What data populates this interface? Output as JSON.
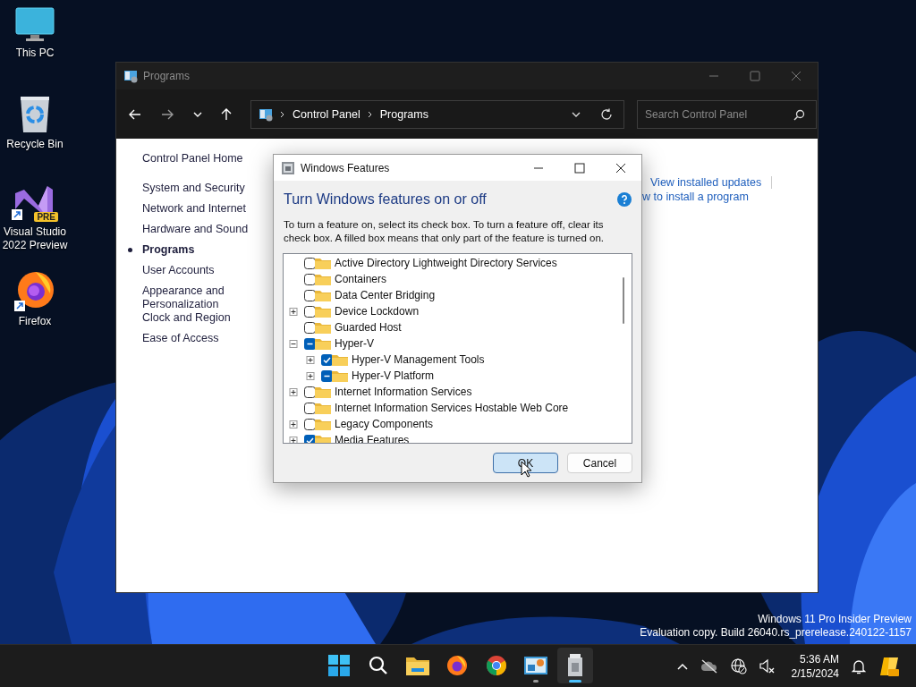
{
  "desktop_icons": [
    {
      "label": "This PC",
      "kind": "monitor"
    },
    {
      "label": "Recycle Bin",
      "kind": "bin"
    },
    {
      "label": "Visual Studio 2022 Preview",
      "kind": "vs",
      "badge": "PRE",
      "shortcut": true
    },
    {
      "label": "Firefox",
      "kind": "firefox",
      "shortcut": true
    }
  ],
  "window": {
    "title": "Programs",
    "breadcrumb": [
      "Control Panel",
      "Programs"
    ],
    "search": {
      "placeholder": "Search Control Panel"
    },
    "nav": [
      {
        "label": "Control Panel Home",
        "selected": false
      },
      {
        "label": "System and Security",
        "selected": false
      },
      {
        "label": "Network and Internet",
        "selected": false
      },
      {
        "label": "Hardware and Sound",
        "selected": false
      },
      {
        "label": "Programs",
        "selected": true
      },
      {
        "label": "User Accounts",
        "selected": false
      },
      {
        "label": "Appearance and Personalization",
        "selected": false
      },
      {
        "label": "Clock and Region",
        "selected": false
      },
      {
        "label": "Ease of Access",
        "selected": false
      }
    ],
    "links": [
      "View installed updates",
      "w to install a program"
    ]
  },
  "dialog": {
    "title": "Windows Features",
    "heading": "Turn Windows features on or off",
    "description": "To turn a feature on, select its check box. To turn a feature off, clear its check box. A filled box means that only part of the feature is turned on.",
    "features": [
      {
        "label": "Active Directory Lightweight Directory Services",
        "checked": false,
        "mixed": false
      },
      {
        "label": "Containers",
        "checked": false,
        "mixed": false
      },
      {
        "label": "Data Center Bridging",
        "checked": false,
        "mixed": false
      },
      {
        "label": "Device Lockdown",
        "expanded": false,
        "checked": false,
        "mixed": false
      },
      {
        "label": "Guarded Host",
        "checked": false,
        "mixed": false
      },
      {
        "label": "Hyper-V",
        "expanded": true,
        "mixed": true,
        "children": [
          {
            "label": "Hyper-V Management Tools",
            "expanded": false,
            "checked": true,
            "mixed": false
          },
          {
            "label": "Hyper-V Platform",
            "expanded": false,
            "mixed": true
          }
        ]
      },
      {
        "label": "Internet Information Services",
        "expanded": false,
        "checked": false,
        "mixed": false
      },
      {
        "label": "Internet Information Services Hostable Web Core",
        "checked": false,
        "mixed": false
      },
      {
        "label": "Legacy Components",
        "expanded": false,
        "checked": false,
        "mixed": false
      },
      {
        "label": "Media Features",
        "expanded": false,
        "checked": true,
        "mixed": false
      }
    ],
    "buttons": [
      {
        "label": "OK",
        "default": true
      },
      {
        "label": "Cancel",
        "default": false
      }
    ]
  },
  "build_info": [
    "Windows 11 Pro Insider Preview",
    "Evaluation copy. Build 26040.rs_prerelease.240122-1157"
  ],
  "taskbar": {
    "apps": [
      {
        "kind": "start",
        "running": false,
        "selected": false
      },
      {
        "kind": "search",
        "running": false,
        "selected": false
      },
      {
        "kind": "folder",
        "running": false,
        "selected": false
      },
      {
        "kind": "firefox",
        "running": false,
        "selected": false
      },
      {
        "kind": "chrome",
        "running": false,
        "selected": false
      },
      {
        "kind": "controlpanel",
        "running": true,
        "selected": false
      },
      {
        "kind": "features",
        "running": true,
        "selected": true
      }
    ],
    "time": "5:36 AM",
    "date": "2/15/2024"
  }
}
